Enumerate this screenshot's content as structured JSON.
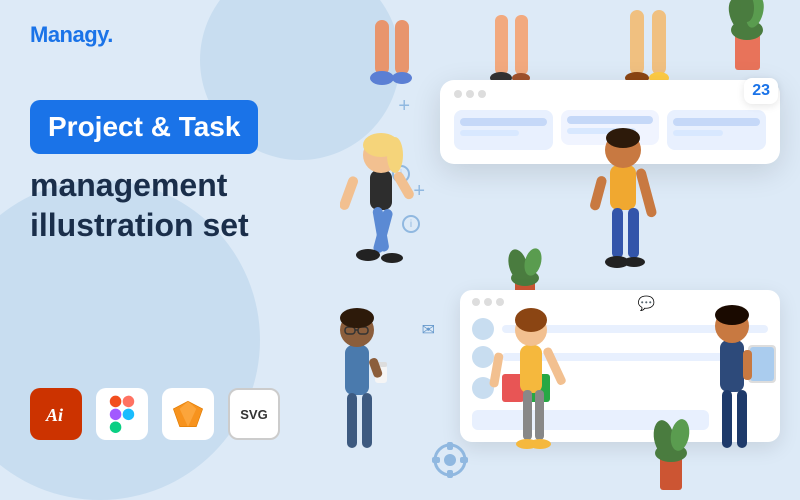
{
  "logo": {
    "text": "Managy."
  },
  "hero": {
    "title_badge": "Project & Task",
    "title_line2": "management",
    "title_line3": "illustration set"
  },
  "format_icons": [
    {
      "id": "ai",
      "label": "Ai",
      "type": "ai"
    },
    {
      "id": "figma",
      "label": "Figma",
      "type": "figma"
    },
    {
      "id": "sketch",
      "label": "Sketch",
      "type": "sketch"
    },
    {
      "id": "svg",
      "label": "SVG",
      "type": "svg"
    }
  ],
  "calendar_number": "23",
  "colors": {
    "brand_blue": "#1a73e8",
    "bg": "#ddeaf7",
    "text_dark": "#1a2e4a"
  }
}
